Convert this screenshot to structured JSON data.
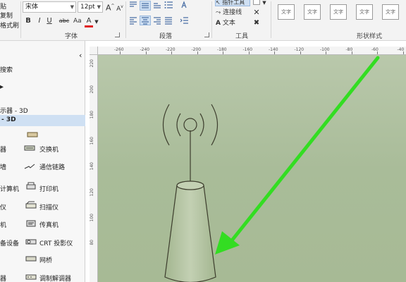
{
  "ribbon": {
    "left_cutoff": [
      "贴",
      "复制",
      "格式刷"
    ],
    "font": {
      "family": "宋体",
      "size": "12pt",
      "grow": "A",
      "shrink": "A",
      "bold": "B",
      "italic": "I",
      "underline": "U",
      "strike": "abc",
      "font_color": "A",
      "group_label": "字体"
    },
    "paragraph": {
      "group_label": "段落"
    },
    "tools": {
      "pointer": "指针工具",
      "connector": "连接线",
      "text": "文本",
      "group_label": "工具"
    },
    "shape_styles": {
      "items": [
        "文字",
        "文字",
        "文字",
        "文字",
        "文字",
        "文字"
      ],
      "group_label": "形状样式"
    }
  },
  "left_panel": {
    "collapse_glyph": "‹",
    "cut_search": "搜索",
    "cut_more": "多",
    "stencil_1": "示器 - 3D",
    "stencil_2_selected": "- 3D",
    "shapes_left_col": [
      "器",
      "墙",
      "计算机",
      "仪",
      "机",
      "备设备",
      "器"
    ],
    "shapes_right_col": [
      "交换机",
      "通信链路",
      "打印机",
      "扫描仪",
      "传真机",
      "CRT 投影仪",
      "网桥",
      "调制解调器"
    ]
  },
  "ruler": {
    "top_labels": [
      "-260",
      "-240",
      "-220",
      "-200",
      "-180",
      "-160",
      "-140",
      "-120",
      "-100",
      "-80",
      "-60",
      "-40"
    ],
    "left_labels": [
      "220",
      "200",
      "180",
      "160",
      "140",
      "120",
      "100",
      "80"
    ]
  },
  "colors": {
    "arrow": "#33dd22",
    "canvas": "#adbf9b",
    "ribbon_bg": "#f3f3f3"
  }
}
